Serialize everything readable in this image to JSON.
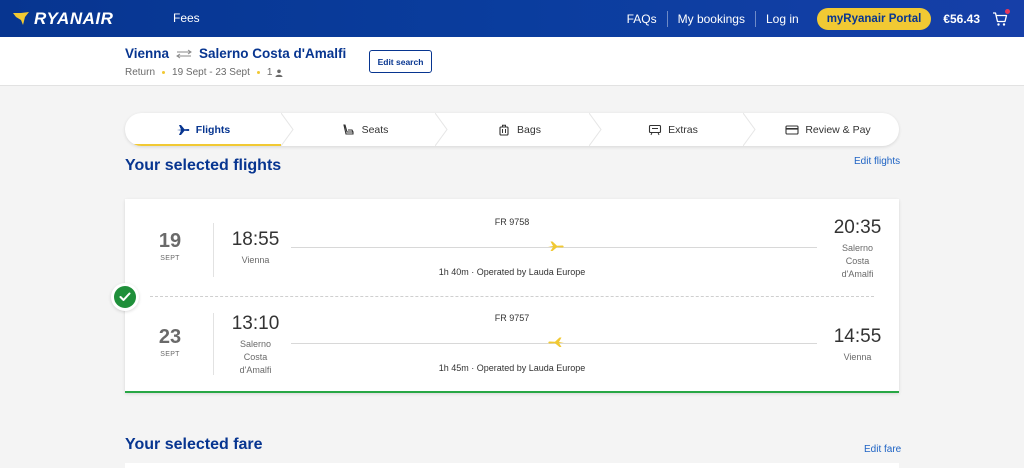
{
  "nav": {
    "logo_text": "RYANAIR",
    "fees": "Fees",
    "faqs": "FAQs",
    "my_bookings": "My bookings",
    "login": "Log in",
    "portal": "myRyanair Portal",
    "price": "€56.43",
    "cart_icon": "cart-icon"
  },
  "trip": {
    "origin": "Vienna",
    "destination": "Salerno Costa d'Amalfi",
    "type": "Return",
    "dates": "19 Sept - 23 Sept",
    "passengers": "1",
    "edit_search": "Edit search"
  },
  "steps": [
    {
      "label": "Flights",
      "icon": "plane-icon",
      "active": true
    },
    {
      "label": "Seats",
      "icon": "seat-icon",
      "active": false
    },
    {
      "label": "Bags",
      "icon": "bag-icon",
      "active": false
    },
    {
      "label": "Extras",
      "icon": "extras-icon",
      "active": false
    },
    {
      "label": "Review & Pay",
      "icon": "card-icon",
      "active": false
    }
  ],
  "selected_flights": {
    "title": "Your selected flights",
    "edit": "Edit flights",
    "legs": [
      {
        "day": "19",
        "month": "SEPT",
        "dep_time": "18:55",
        "dep_city": "Vienna",
        "arr_time": "20:35",
        "arr_city": "Salerno Costa d'Amalfi",
        "flight_no": "FR 9758",
        "info": "1h 40m · Operated by Lauda Europe"
      },
      {
        "day": "23",
        "month": "SEPT",
        "dep_time": "13:10",
        "dep_city": "Salerno Costa d'Amalfi",
        "arr_time": "14:55",
        "arr_city": "Vienna",
        "flight_no": "FR 9757",
        "info": "1h 45m · Operated by Lauda Europe"
      }
    ]
  },
  "selected_fare": {
    "title": "Your selected fare",
    "edit": "Edit fare"
  },
  "colors": {
    "brand_blue": "#073590",
    "accent_yellow": "#f1c933",
    "success_green": "#1f8f3a"
  }
}
